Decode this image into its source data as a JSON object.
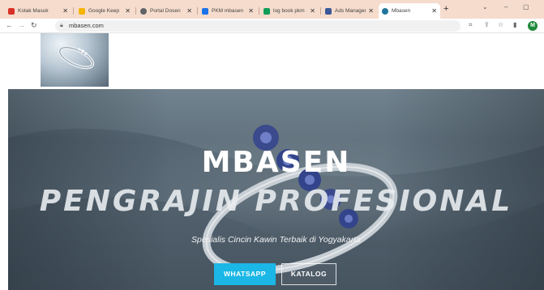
{
  "browser": {
    "tabs": [
      {
        "title": "Kotak Masuk",
        "color": "#d93025"
      },
      {
        "title": "Google Keep",
        "color": "#f4b400"
      },
      {
        "title": "Portal Dosen",
        "color": "#5f6368"
      },
      {
        "title": "PKM mbasen",
        "color": "#1a73e8"
      },
      {
        "title": "log book pkm",
        "color": "#0f9d58"
      },
      {
        "title": "Ads Manager",
        "color": "#3b5998"
      },
      {
        "title": "Mbasen",
        "color": "#21759b"
      }
    ],
    "new_tab_label": "+",
    "url": "mbasen.com",
    "profile_initial": "M"
  },
  "hero": {
    "title": "MBASEN",
    "subtitle": "PENGRAJIN PROFESIONAL",
    "tagline": "Spesialis Cincin Kawin Terbaik di Yogyakarta",
    "whatsapp_label": "WHATSAPP",
    "katalog_label": "KATALOG"
  },
  "colors": {
    "tabbar_bg": "#f5dccd",
    "whatsapp_button": "#1bb7e6",
    "profile_avatar": "#1f8a3a"
  }
}
